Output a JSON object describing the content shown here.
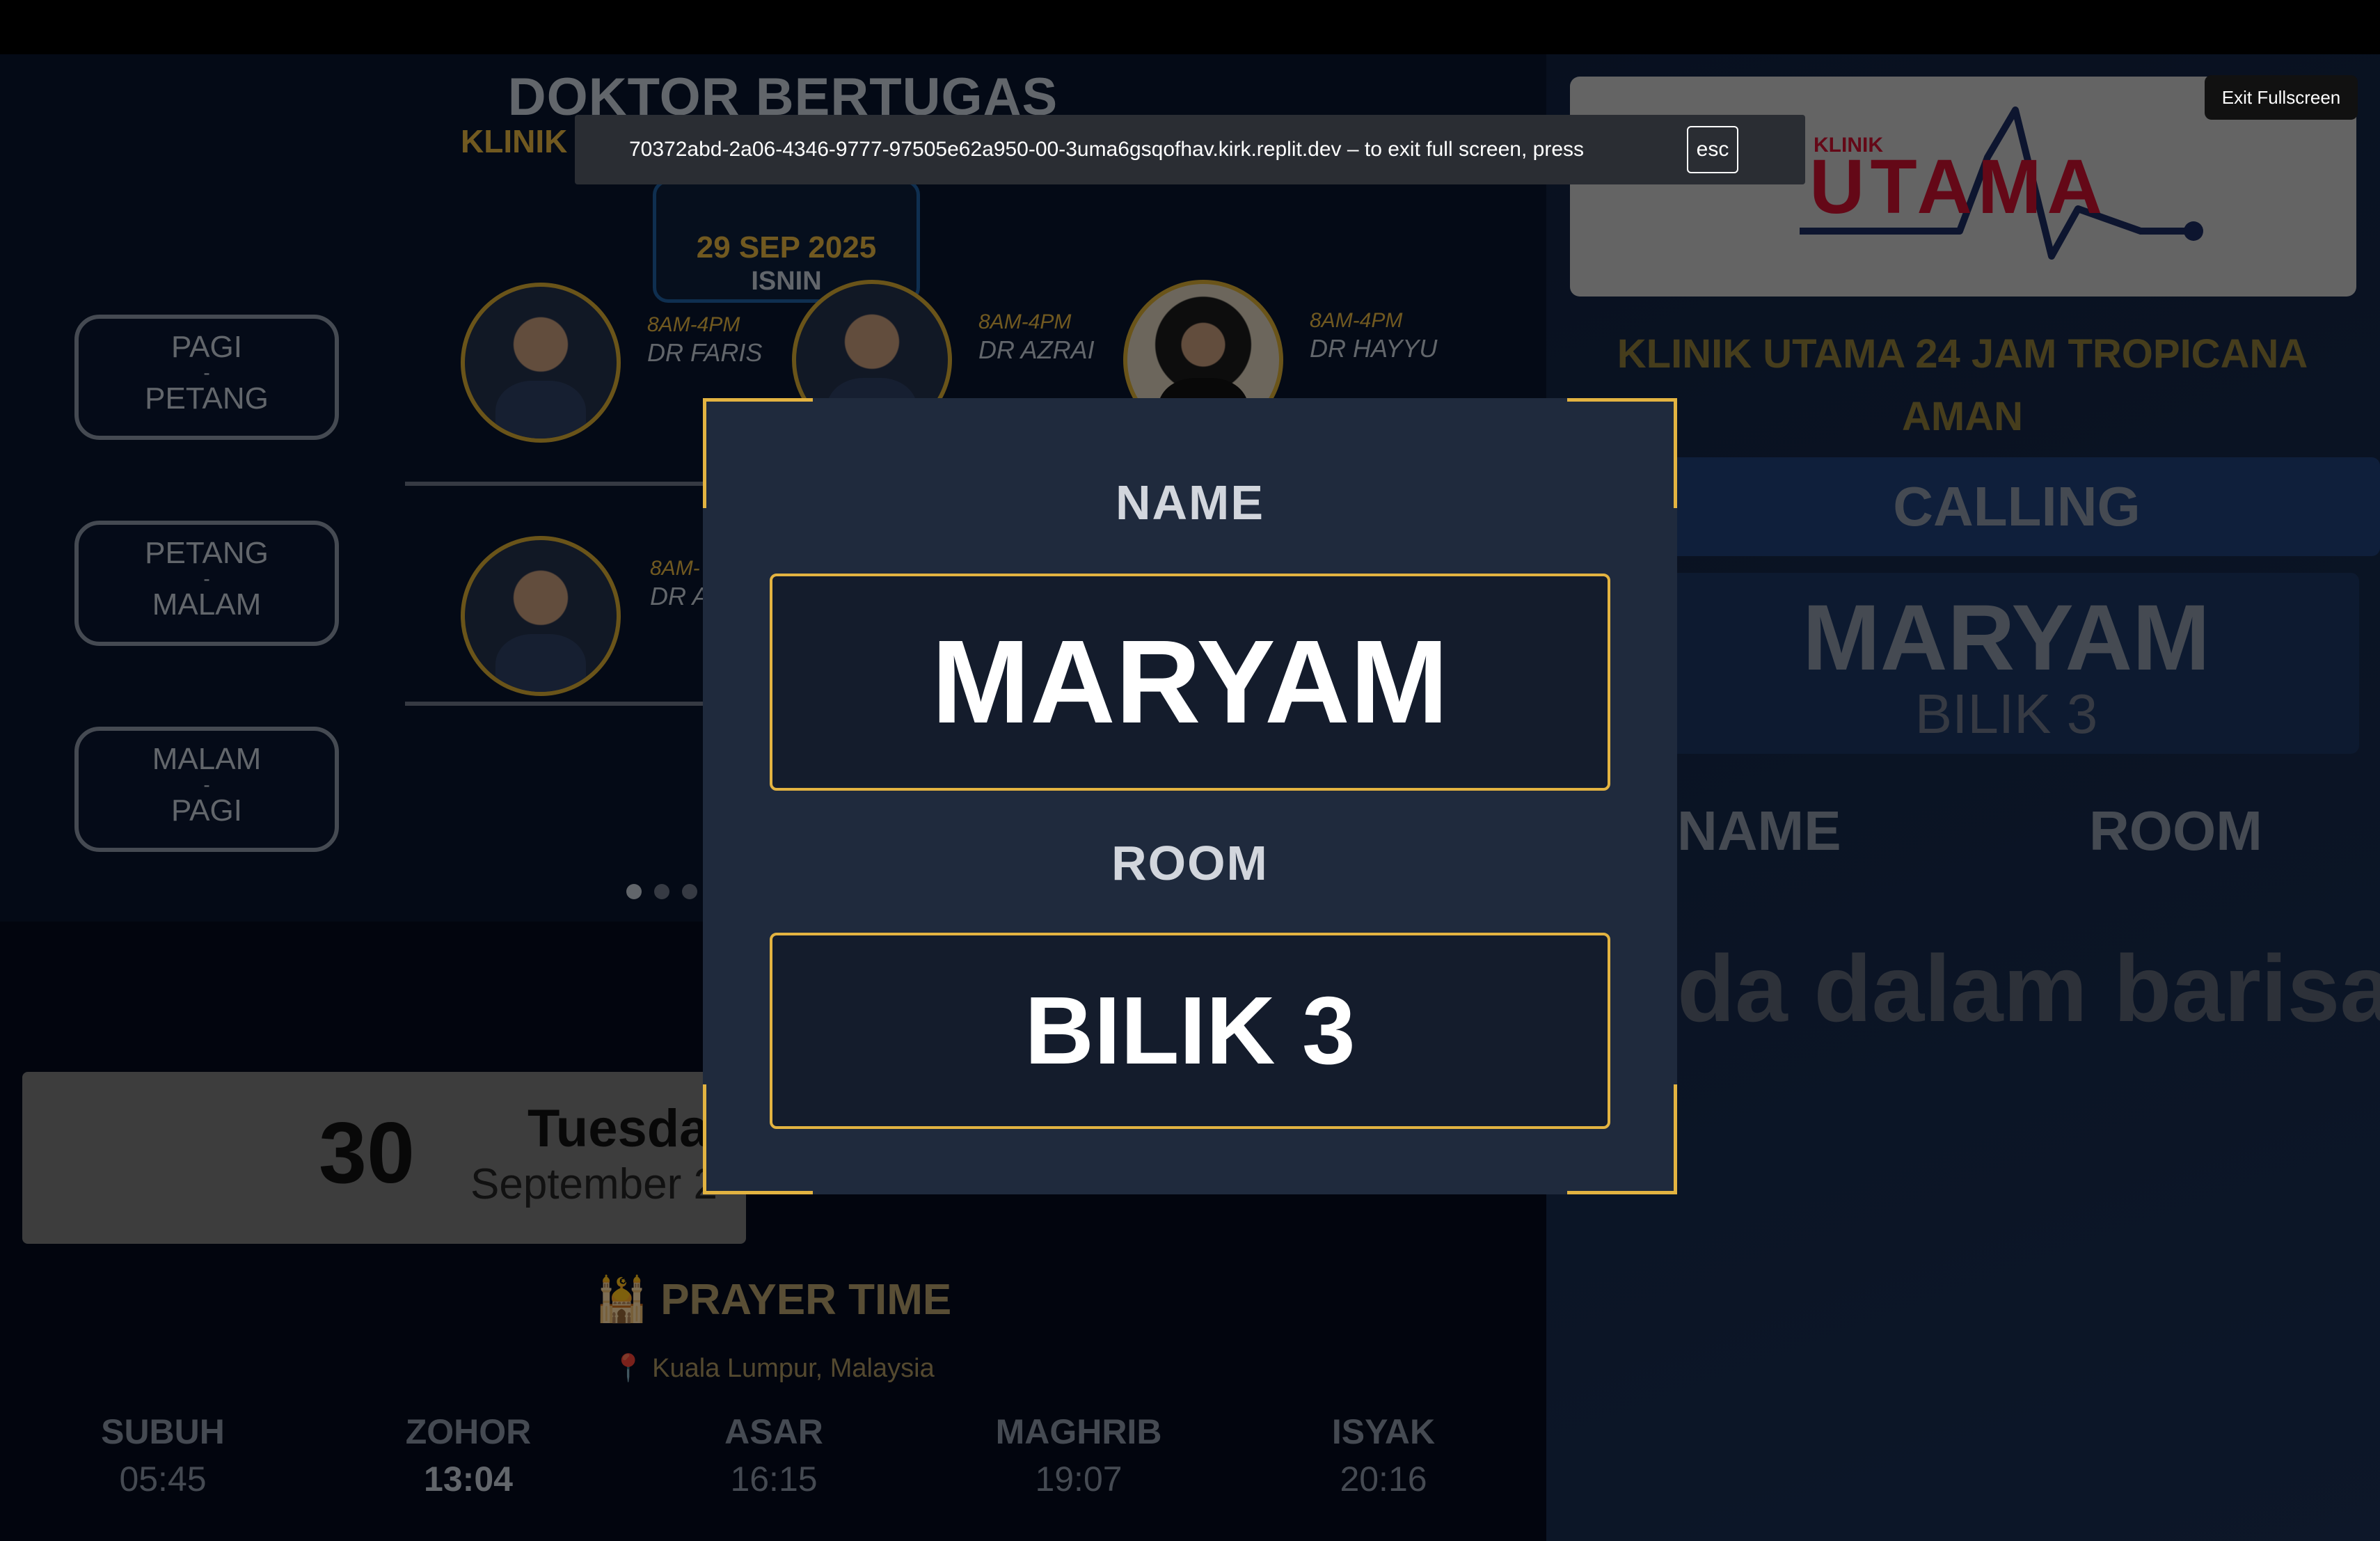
{
  "browser": {
    "fullscreen_url_message": "70372abd-2a06-4346-9777-97505e62a950-00-3uma6gsqofhav.kirk.replit.dev – to exit full screen, press",
    "esc_key": "esc",
    "exit_fullscreen_label": "Exit Fullscreen"
  },
  "roster": {
    "title": "DOKTOR BERTUGAS",
    "klinik_tag": "KLINIK",
    "date": "29 SEP 2025",
    "day": "ISNIN",
    "shifts": [
      {
        "line1": "PAGI",
        "sep": "-",
        "line2": "PETANG"
      },
      {
        "line1": "PETANG",
        "sep": "-",
        "line2": "MALAM"
      },
      {
        "line1": "MALAM",
        "sep": "-",
        "line2": "PAGI"
      }
    ],
    "doctors": [
      {
        "time": "8AM-4PM",
        "name": "DR FARIS",
        "icon": "doctor-photo"
      },
      {
        "time": "8AM-4PM",
        "name": "DR AZRAI",
        "icon": "doctor-photo"
      },
      {
        "time": "8AM-4PM",
        "name": "DR HAYYU",
        "icon": "doctor-photo"
      },
      {
        "time": "8AM-",
        "name": "DR A",
        "icon": "doctor-photo"
      }
    ]
  },
  "clock": {
    "day_number": "30",
    "weekday": "Tuesday",
    "month_year": "September 2"
  },
  "prayer": {
    "title": "🕌 PRAYER TIME",
    "location": "📍 Kuala Lumpur, Malaysia",
    "times": [
      {
        "name": "SUBUH",
        "time": "05:45"
      },
      {
        "name": "ZOHOR",
        "time": "13:04",
        "active": true
      },
      {
        "name": "ASAR",
        "time": "16:15"
      },
      {
        "name": "MAGHRIB",
        "time": "19:07"
      },
      {
        "name": "ISYAK",
        "time": "20:16"
      }
    ]
  },
  "queue_panel": {
    "logo_small": "KLINIK",
    "logo_big": "UTAMA",
    "clinic_name": "KLINIK UTAMA 24 JAM TROPICANA AMAN",
    "calling_label": "CALLING",
    "calling_name": "MARYAM",
    "calling_room": "BILIK 3",
    "col_name": "NAME",
    "col_room": "ROOM",
    "empty_message": "da dalam barisan"
  },
  "modal": {
    "name_label": "NAME",
    "name_value": "MARYAM",
    "room_label": "ROOM",
    "room_value": "BILIK 3"
  },
  "colors": {
    "accent": "#e3b341",
    "logo_red": "#c8102e",
    "logo_navy": "#1b2a5e"
  }
}
